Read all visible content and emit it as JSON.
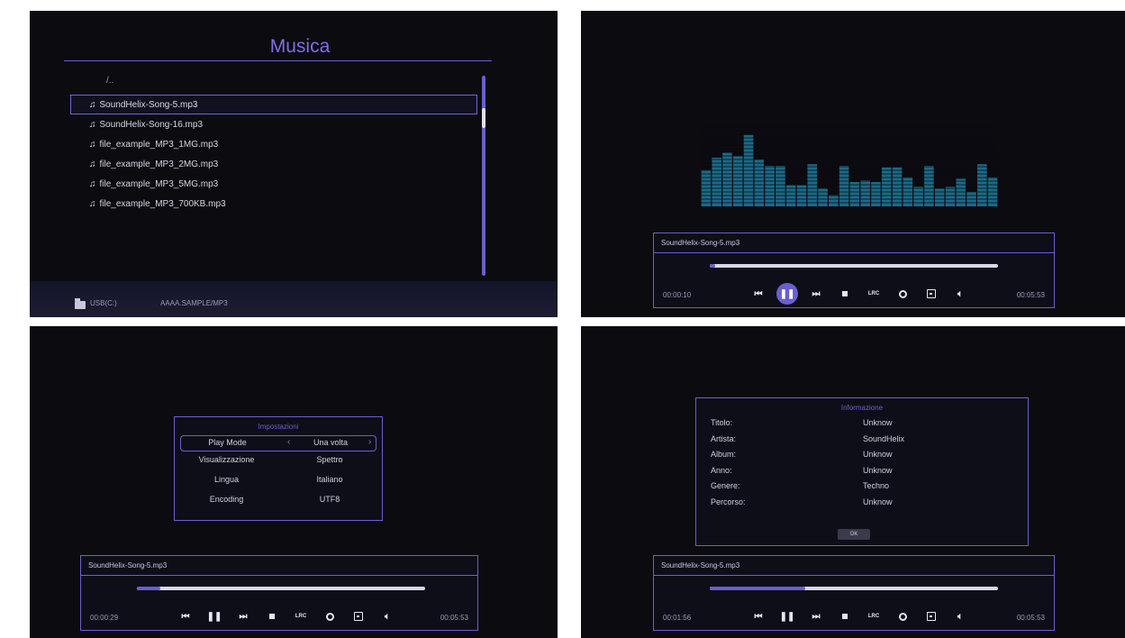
{
  "browser": {
    "title": "Musica",
    "parent": "/..",
    "files": [
      "SoundHelix-Song-5.mp3",
      "SoundHelix-Song-16.mp3",
      "file_example_MP3_1MG.mp3",
      "file_example_MP3_2MG.mp3",
      "file_example_MP3_5MG.mp3",
      "file_example_MP3_700KB.mp3"
    ],
    "selected_index": 0,
    "usb": "USB(C:)",
    "path": "AAAA.SAMPLE/MP3",
    "note_icon": "music-note-icon",
    "folder_icon": "folder-icon"
  },
  "spectrum": {
    "color": "#1b6a86",
    "levels": [
      0.45,
      0.6,
      0.66,
      0.62,
      0.88,
      0.58,
      0.5,
      0.5,
      0.26,
      0.26,
      0.52,
      0.22,
      0.14,
      0.5,
      0.3,
      0.32,
      0.3,
      0.48,
      0.48,
      0.36,
      0.24,
      0.5,
      0.22,
      0.24,
      0.34,
      0.18,
      0.52,
      0.36
    ]
  },
  "player_playing": {
    "song": "SoundHelix-Song-5.mp3",
    "current": "00:00:10",
    "total": "00:05:53",
    "progress": 0.02,
    "lrc": "LRC"
  },
  "player_settings": {
    "song": "SoundHelix-Song-5.mp3",
    "current": "00:00:29",
    "total": "00:05:53",
    "progress": 0.08,
    "lrc": "LRC"
  },
  "player_info": {
    "song": "SoundHelix-Song-5.mp3",
    "current": "00:01:56",
    "total": "00:05:53",
    "progress": 0.33,
    "lrc": "LRC"
  },
  "settings": {
    "title": "Impostazioni",
    "rows": [
      {
        "key": "Play Mode",
        "value": "Una volta"
      },
      {
        "key": "Visualizzazione",
        "value": "Spettro"
      },
      {
        "key": "Lingua",
        "value": "Italiano"
      },
      {
        "key": "Encoding",
        "value": "UTF8"
      }
    ],
    "arrow_left": "‹",
    "arrow_right": "›"
  },
  "info": {
    "title": "Informazione",
    "rows": [
      {
        "key": "Titolo:",
        "value": "Unknow"
      },
      {
        "key": "Artista:",
        "value": "SoundHelix"
      },
      {
        "key": "Album:",
        "value": "Unknow"
      },
      {
        "key": "Anno:",
        "value": "Unknow"
      },
      {
        "key": "Genere:",
        "value": "Techno"
      },
      {
        "key": "Percorso:",
        "value": "Unknow"
      }
    ],
    "ok": "OK"
  },
  "colors": {
    "accent": "#6a5fd0",
    "background": "#0b0b10",
    "text": "#d0d0e0"
  }
}
